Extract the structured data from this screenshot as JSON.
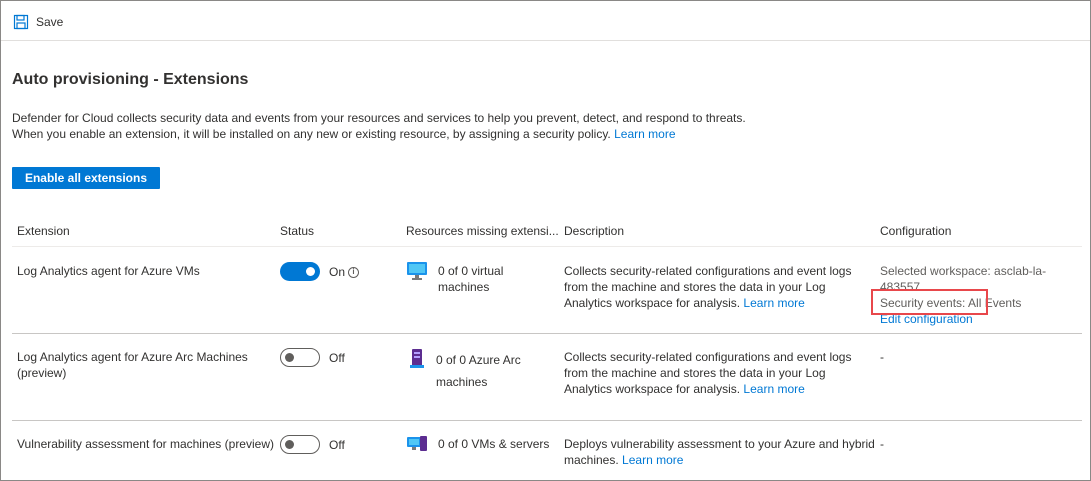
{
  "toolbar": {
    "save_label": "Save",
    "save_icon": "floppy-disk-icon"
  },
  "page": {
    "title": "Auto provisioning - Extensions",
    "description_line1": "Defender for Cloud collects security data and events from your resources and services to help you prevent, detect, and respond to threats.",
    "description_line2": "When you enable an extension, it will be installed on any new or existing resource, by assigning a security policy.",
    "learn_more": "Learn more",
    "enable_all_button": "Enable all extensions"
  },
  "table": {
    "headers": {
      "extension": "Extension",
      "status": "Status",
      "resources": "Resources missing extensi...",
      "description": "Description",
      "configuration": "Configuration"
    },
    "rows": [
      {
        "extension": "Log Analytics agent for Azure VMs",
        "status": "On",
        "status_on": true,
        "resource_icon": "virtual-machine-icon",
        "resources": "0 of 0 virtual machines",
        "description": "Collects security-related configurations and event logs from the machine and stores the data in your Log Analytics workspace for analysis.",
        "learn_more": "Learn more",
        "config_workspace": "Selected workspace: asclab-la-483557",
        "config_events": "Security events: All Events",
        "config_link": "Edit configuration"
      },
      {
        "extension": "Log Analytics agent for Azure Arc Machines (preview)",
        "status": "Off",
        "status_on": false,
        "resource_icon": "azure-arc-server-icon",
        "resources": "0 of 0 Azure Arc machines",
        "description": "Collects security-related configurations and event logs from the machine and stores the data in your Log Analytics workspace for analysis.",
        "learn_more": "Learn more",
        "config": "-"
      },
      {
        "extension": "Vulnerability assessment for machines (preview)",
        "status": "Off",
        "status_on": false,
        "resource_icon": "vms-and-servers-icon",
        "resources": "0 of 0 VMs & servers",
        "description": "Deploys vulnerability assessment to your Azure and hybrid machines.",
        "learn_more": "Learn more",
        "config": "-"
      }
    ]
  },
  "colors": {
    "accent": "#0078d4",
    "highlight": "#e8474b"
  }
}
